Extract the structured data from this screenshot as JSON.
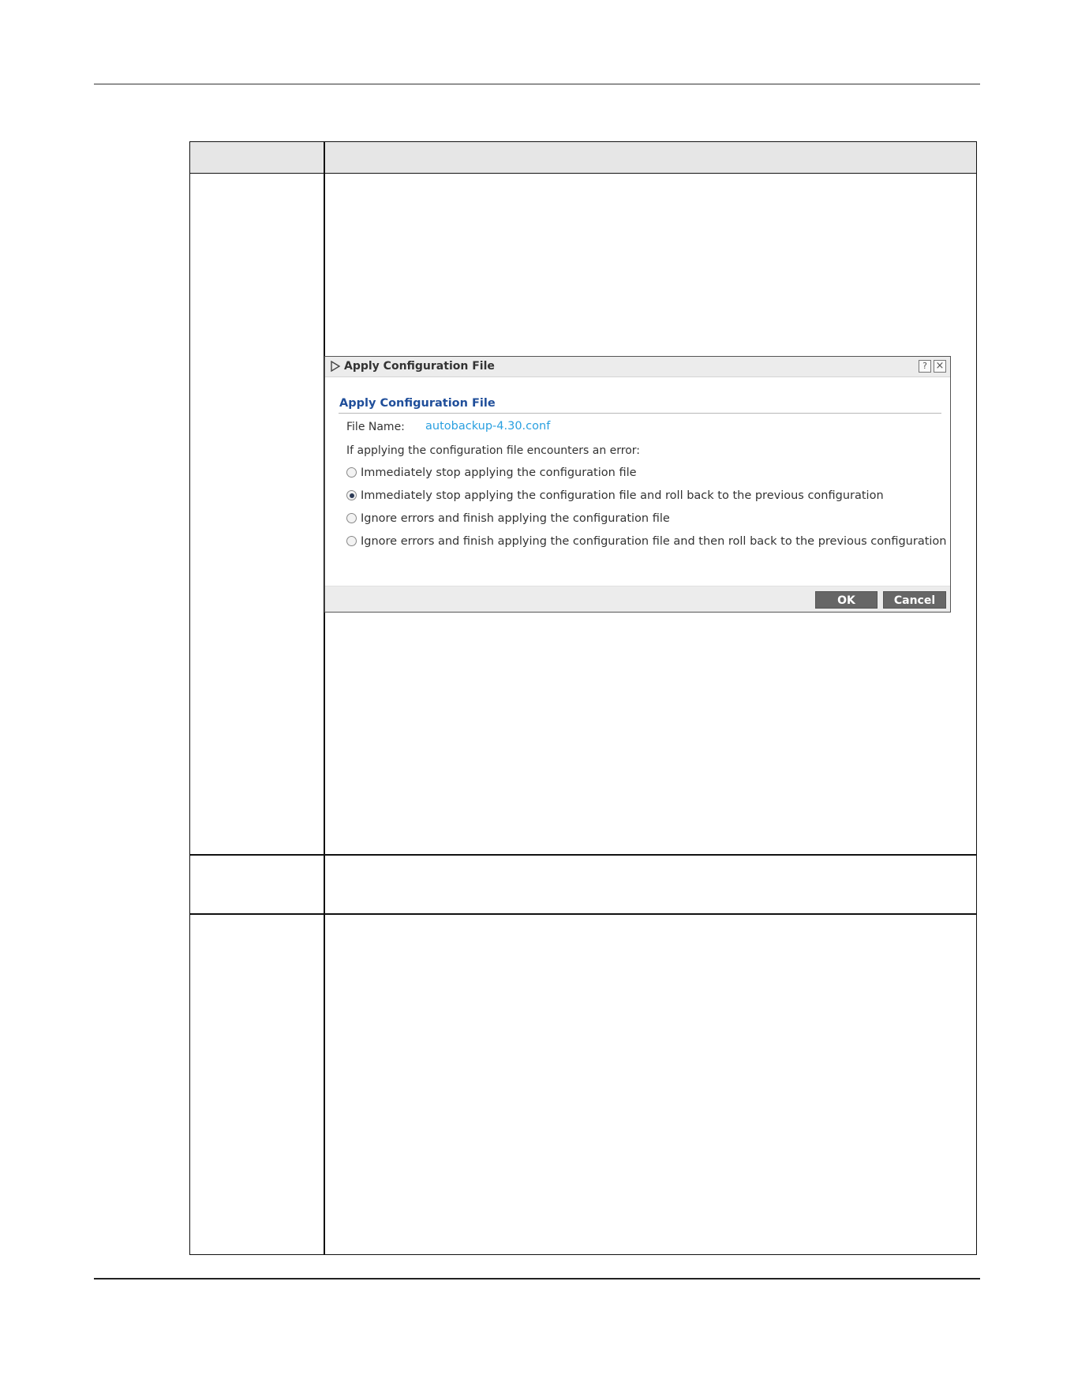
{
  "dialog": {
    "title": "Apply Configuration File",
    "help_glyph": "?",
    "close_glyph": "×",
    "section_title": "Apply Configuration File",
    "file_name_label": "File Name:",
    "file_name_value": "autobackup-4.30.conf",
    "error_question": "If applying the configuration file encounters an error:",
    "options": [
      {
        "label": "Immediately stop applying the configuration file",
        "selected": false
      },
      {
        "label": "Immediately stop applying the configuration file and roll back to the previous configuration",
        "selected": true
      },
      {
        "label": "Ignore errors and finish applying the configuration file",
        "selected": false
      },
      {
        "label": "Ignore errors and finish applying the configuration file and then roll back to the previous configuration",
        "selected": false
      }
    ],
    "ok_label": "OK",
    "cancel_label": "Cancel"
  },
  "colors": {
    "section_title": "#1f4e9a",
    "file_name_link": "#2aa0e0",
    "button_bg": "#666666",
    "table_header_bg": "#e6e6e6"
  }
}
